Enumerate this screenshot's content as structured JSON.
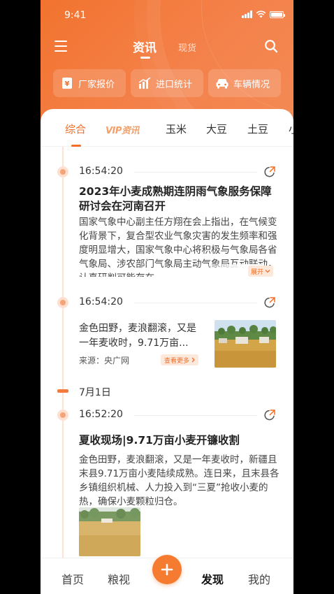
{
  "status_bar": {
    "time": "9:41"
  },
  "header": {
    "tab_active": "资讯",
    "tab_other": "现货",
    "quick_links": [
      {
        "label": "厂家报价",
        "icon": "price-tag-icon"
      },
      {
        "label": "进口统计",
        "icon": "bar-chart-icon"
      },
      {
        "label": "车辆情况",
        "icon": "car-icon"
      }
    ]
  },
  "categories": [
    "综合",
    "VIP资讯",
    "玉米",
    "大豆",
    "土豆",
    "小"
  ],
  "active_category": "综合",
  "feed": {
    "item1": {
      "time": "16:54:20",
      "title": "2023年小麦成熟期连阴雨气象服务保障研讨会在河南召开",
      "body": "国家气象中心副主任方翔在会上指出，在气候变化背景下，复合型农业气象灾害的发生频率和强度明显增大，国家气象中心将积极与气象局各省气象局、涉农部门气象局主动气象局互动联动，认真研判可能存在",
      "expand_label": "展开"
    },
    "item2": {
      "time": "16:54:20",
      "snippet": "金色田野，麦浪翻滚，又是一年麦收时，9.71万亩...",
      "source": "来源：央广网",
      "more_label": "查看更多"
    },
    "date_group": "7月1日",
    "item3": {
      "time": "16:52:20",
      "title": "夏收现场|9.71万亩小麦开镰收割",
      "body": "金色田野，麦浪翻滚，又是一年麦收时，新疆且末县9.71万亩小麦陆续成熟。连日来，且末县各乡镇组织机械、人力投入到“三夏”抢收小麦的热，确保小麦颗粒归仓。"
    }
  },
  "tabbar": {
    "home": "首页",
    "grain_view": "粮视",
    "discover": "发现",
    "mine": "我的"
  },
  "colors": {
    "accent": "#f36d24",
    "header_bg": "#f2732e"
  }
}
